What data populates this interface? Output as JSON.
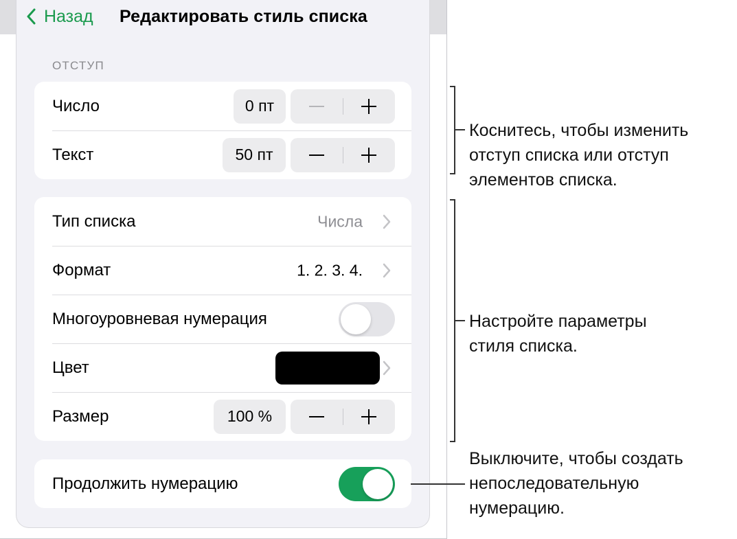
{
  "nav": {
    "back_label": "Назад",
    "title": "Редактировать стиль списка"
  },
  "indent_section": {
    "header": "ОТСТУП",
    "rows": [
      {
        "label": "Число",
        "value": "0 пт"
      },
      {
        "label": "Текст",
        "value": "50 пт"
      }
    ]
  },
  "style_section": {
    "list_type": {
      "label": "Тип списка",
      "value": "Числа"
    },
    "format": {
      "label": "Формат",
      "value": "1. 2. 3. 4."
    },
    "multilevel": {
      "label": "Многоуровневая нумерация",
      "on": false
    },
    "color": {
      "label": "Цвет",
      "swatch": "#000000"
    },
    "size": {
      "label": "Размер",
      "value": "100 %"
    }
  },
  "continue_section": {
    "label": "Продолжить нумерацию",
    "on": true
  },
  "callouts": {
    "indent": [
      "Коснитесь, чтобы изменить",
      "отступ списка или отступ",
      "элементов списка."
    ],
    "style": [
      "Настройте параметры",
      "стиля списка."
    ],
    "continue": [
      "Выключите, чтобы создать",
      "непоследовательную",
      "нумерацию."
    ]
  },
  "colors": {
    "accent_green": "#17a05a",
    "back_green": "#1a9a4d",
    "group_bg": "#ffffff",
    "popover_bg": "#f2f2f7"
  }
}
